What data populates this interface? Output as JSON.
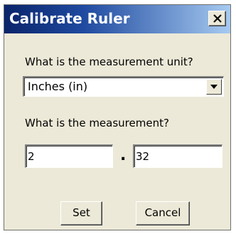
{
  "window": {
    "title": "Calibrate Ruler",
    "close_icon": "close-icon"
  },
  "unit": {
    "label": "What is the measurement unit?",
    "selected": "Inches (in)",
    "dropdown_icon": "chevron-down-icon"
  },
  "measurement": {
    "label": "What is the measurement?",
    "integer_value": "2",
    "separator": ".",
    "fraction_value": "32"
  },
  "buttons": {
    "set_label": "Set",
    "cancel_label": "Cancel"
  }
}
